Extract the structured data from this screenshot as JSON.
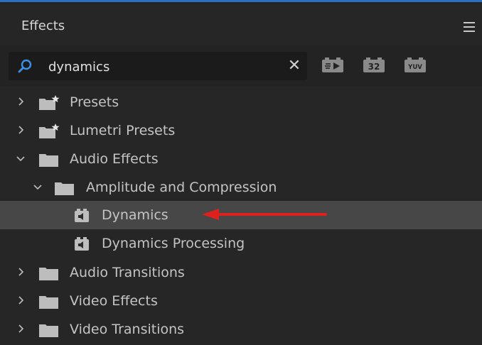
{
  "panel": {
    "title": "Effects",
    "accent_color": "#2d6fc4",
    "menu_icon": "hamburger-menu-icon"
  },
  "search": {
    "value": "dynamics",
    "placeholder": "",
    "search_icon": "search-icon",
    "clear_icon": "close-icon",
    "clear_glyph": "✕"
  },
  "filters": [
    {
      "name": "accelerated-effects-filter",
      "label": ""
    },
    {
      "name": "32-bit-color-filter",
      "label": "32"
    },
    {
      "name": "yuv-effects-filter",
      "label": "YUV"
    }
  ],
  "tree": {
    "items": [
      {
        "label": "Presets",
        "icon": "preset-folder-icon",
        "expanded": false
      },
      {
        "label": "Lumetri Presets",
        "icon": "preset-folder-icon",
        "expanded": false
      },
      {
        "label": "Audio Effects",
        "icon": "folder-icon",
        "expanded": true
      },
      {
        "label": "Amplitude and Compression",
        "icon": "folder-icon",
        "expanded": true
      },
      {
        "label": "Dynamics",
        "icon": "audio-effect-icon",
        "selected": true
      },
      {
        "label": "Dynamics Processing",
        "icon": "audio-effect-icon",
        "selected": false
      },
      {
        "label": "Audio Transitions",
        "icon": "folder-icon",
        "expanded": false
      },
      {
        "label": "Video Effects",
        "icon": "folder-icon",
        "expanded": false
      },
      {
        "label": "Video Transitions",
        "icon": "folder-icon",
        "expanded": false
      }
    ]
  },
  "annotation": {
    "arrow_color": "#e0201c"
  }
}
